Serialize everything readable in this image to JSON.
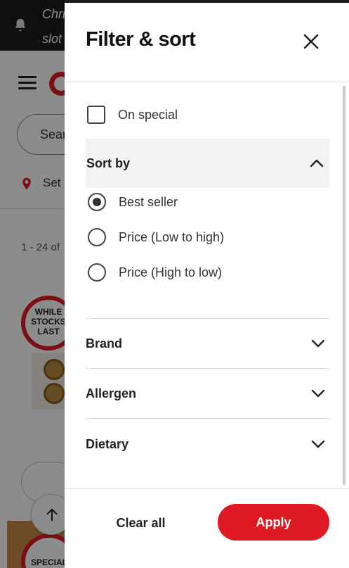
{
  "background": {
    "banner_line1": "Chri",
    "banner_line2": "slot",
    "search_placeholder": "Sear",
    "set_location": "Set s",
    "results_count": "1 - 24 of",
    "badge1_text": "WHILE STOCKS LAST",
    "badge2_text": "SPECIAL"
  },
  "drawer": {
    "title": "Filter & sort",
    "on_special": {
      "label": "On special",
      "checked": false
    },
    "sort_by": {
      "label": "Sort by",
      "expanded": true,
      "options": [
        {
          "label": "Best seller",
          "selected": true
        },
        {
          "label": "Price (Low to high)",
          "selected": false
        },
        {
          "label": "Price (High to low)",
          "selected": false
        }
      ]
    },
    "sections": [
      {
        "label": "Brand"
      },
      {
        "label": "Allergen"
      },
      {
        "label": "Dietary"
      }
    ],
    "footer": {
      "clear_label": "Clear all",
      "apply_label": "Apply"
    }
  },
  "colors": {
    "accent": "#e01a22",
    "overlay": "rgba(0,0,0,0.45)",
    "banner": "#1c1c1c",
    "section_bg": "#f2f2f2"
  },
  "icons": [
    "bell-icon",
    "menu-icon",
    "location-pin-icon",
    "arrow-up-icon",
    "close-icon",
    "chevron-up-icon",
    "chevron-down-icon"
  ]
}
